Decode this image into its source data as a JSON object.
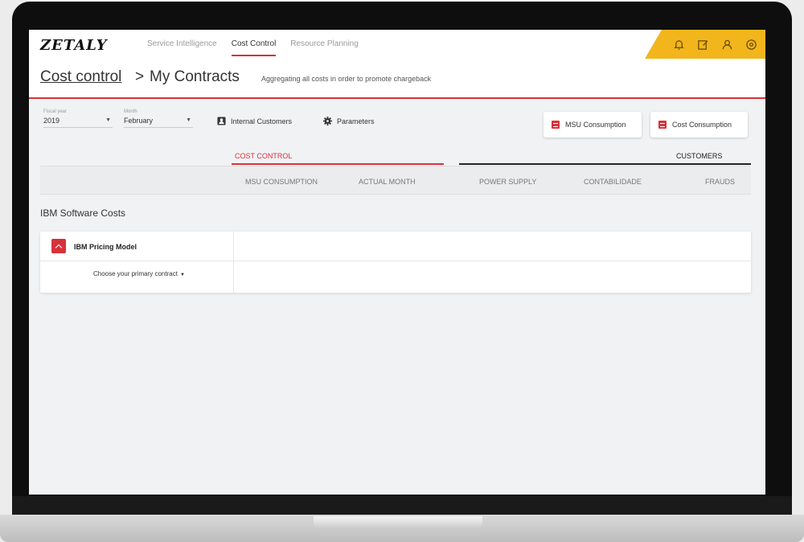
{
  "app": {
    "logo": "ZETALY"
  },
  "nav": {
    "items": [
      {
        "label": "Service Intelligence",
        "active": false
      },
      {
        "label": "Cost Control",
        "active": true
      },
      {
        "label": "Resource Planning",
        "active": false
      }
    ]
  },
  "topbar_icons": [
    "bell-icon",
    "edit-icon",
    "user-icon",
    "settings-icon"
  ],
  "colors": {
    "accent": "#d6323a",
    "topbar_icons_bg": "#f2b51c"
  },
  "header": {
    "breadcrumb_link": "Cost control",
    "separator": ">",
    "page_title": "My Contracts",
    "description": "Aggregating all costs in order to promote chargeback"
  },
  "filters": {
    "year": {
      "label": "Fiscal year",
      "value": "2019"
    },
    "month": {
      "label": "Month",
      "value": "February"
    }
  },
  "actions": {
    "internal_customers": "Internal Customers",
    "parameters": "Parameters",
    "msu_consumption": "MSU Consumption",
    "cost_consumption": "Cost Consumption"
  },
  "table": {
    "groups": {
      "cost_control": "COST CONTROL",
      "customers": "CUSTOMERS"
    },
    "columns": [
      "MSU CONSUMPTION",
      "ACTUAL MONTH",
      "POWER SUPPLY",
      "CONTABILIDADE",
      "FRAUDS"
    ]
  },
  "section": {
    "title": "IBM Software Costs",
    "panel_title": "IBM Pricing Model",
    "contract_select": "Choose your primary contract"
  }
}
